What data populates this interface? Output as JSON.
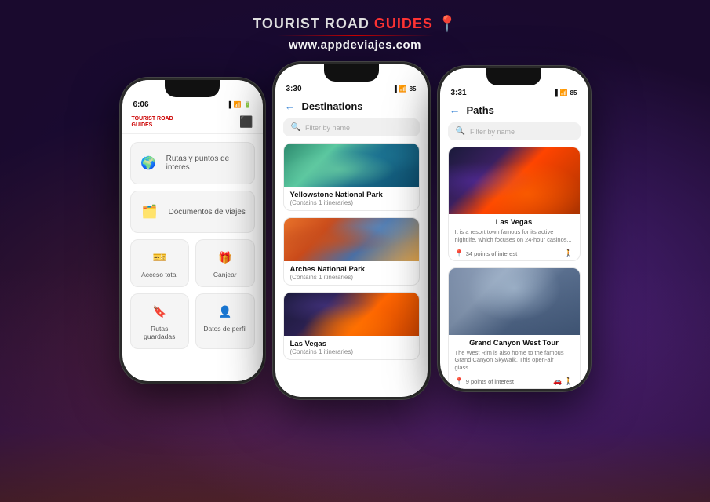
{
  "header": {
    "logo_tourist": "TOURIST",
    "logo_road": "ROAD",
    "logo_guides": "GUIDES",
    "logo_pin": "📍",
    "url": "www.appdeviajes.com"
  },
  "phone1": {
    "status_time": "6:06",
    "app_logo_line1": "TOURIST ROAD",
    "app_logo_line2": "GUIDES",
    "menu_items": [
      {
        "label": "Rutas y puntos de interes",
        "icon": "🌍"
      },
      {
        "label": "Documentos de viajes",
        "icon": "🗂️"
      }
    ],
    "menu_items_row1": [
      {
        "label": "Acceso total",
        "icon": "🎫"
      },
      {
        "label": "Canjear",
        "icon": "🎁"
      }
    ],
    "menu_items_row2": [
      {
        "label": "Rutas guardadas",
        "icon": "🔖"
      },
      {
        "label": "Datos de perfil",
        "icon": "👤"
      }
    ]
  },
  "phone2": {
    "status_time": "3:30",
    "screen_title": "Destinations",
    "search_placeholder": "Filter by name",
    "destinations": [
      {
        "name": "Yellowstone National Park",
        "sub": "(Contains 1 itineraries)",
        "img": "yellowstone"
      },
      {
        "name": "Arches National Park",
        "sub": "(Contains 1 itineraries)",
        "img": "arches"
      },
      {
        "name": "Las Vegas",
        "sub": "(Contains 1 itineraries)",
        "img": "lasvegas"
      }
    ]
  },
  "phone3": {
    "status_time": "3:31",
    "screen_title": "Paths",
    "search_placeholder": "Filter by name",
    "paths": [
      {
        "name": "Las Vegas",
        "desc": "It is a resort town famous for its active nightlife, which focuses on 24-hour casinos...",
        "poi": "34 points of interest",
        "img": "lasvegas2",
        "icons": [
          "🚶"
        ]
      },
      {
        "name": "Grand Canyon West Tour",
        "desc": "The West Rim is also home to the famous Grand Canyon Skywalk. This open-air glass...",
        "poi": "9 points of interest",
        "img": "grandcanyon",
        "icons": [
          "🚗",
          "🚶"
        ]
      }
    ]
  }
}
